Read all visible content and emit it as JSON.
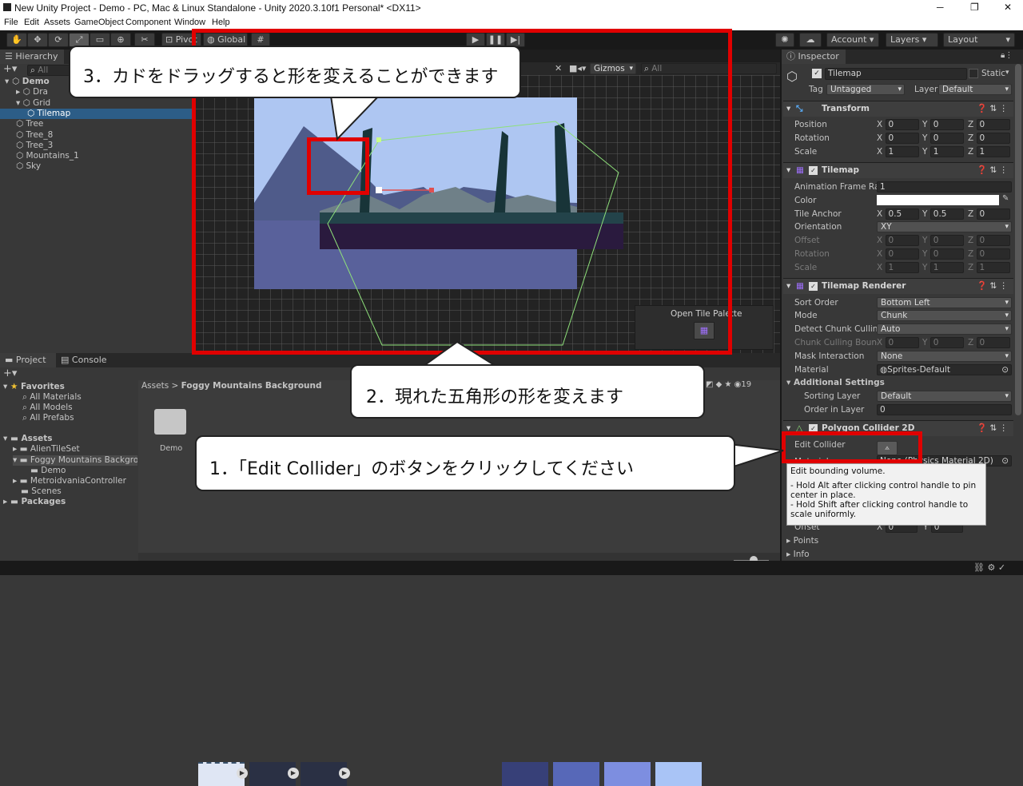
{
  "window": {
    "title": "New Unity Project - Demo - PC, Mac & Linux Standalone - Unity 2020.3.10f1 Personal* <DX11>",
    "controls": [
      "─",
      "❐",
      "✕"
    ]
  },
  "menu": [
    "File",
    "Edit",
    "Assets",
    "GameObject",
    "Component",
    "Window",
    "Help"
  ],
  "toolbar": {
    "pivot": "Pivot",
    "global": "Global",
    "account": "Account",
    "layers": "Layers",
    "layout": "Layout"
  },
  "hierarchy": {
    "tab": "Hierarchy",
    "search_placeholder": "All",
    "items": [
      {
        "label": "Demo",
        "indent": 0,
        "expanded": true,
        "bold": true
      },
      {
        "label": "Dra",
        "indent": 1,
        "expanded": false
      },
      {
        "label": "Grid",
        "indent": 1,
        "expanded": true
      },
      {
        "label": "Tilemap",
        "indent": 2,
        "selected": true
      },
      {
        "label": "Tree",
        "indent": 1
      },
      {
        "label": "Tree_8",
        "indent": 1
      },
      {
        "label": "Tree_3",
        "indent": 1
      },
      {
        "label": "Mountains_1",
        "indent": 1
      },
      {
        "label": "Sky",
        "indent": 1
      }
    ]
  },
  "scene": {
    "gizmos": "Gizmos",
    "search_placeholder": "All",
    "tile_palette_button": "Open Tile Palette"
  },
  "project": {
    "tabs": [
      "Project",
      "Console"
    ],
    "favorites": {
      "label": "Favorites",
      "items": [
        "All Materials",
        "All Models",
        "All Prefabs"
      ]
    },
    "assets": {
      "label": "Assets",
      "items": [
        {
          "label": "AlienTileSet",
          "indent": 1
        },
        {
          "label": "Foggy Mountains Backgrou",
          "indent": 1,
          "expanded": true
        },
        {
          "label": "Demo",
          "indent": 2
        },
        {
          "label": "MetroidvaniaController",
          "indent": 1
        },
        {
          "label": "Scenes",
          "indent": 1
        }
      ]
    },
    "packages": "Packages",
    "breadcrumb": [
      "Assets",
      "Foggy Mountains Background"
    ],
    "folder_label": "Demo",
    "asset_count": "19"
  },
  "inspector": {
    "tab": "Inspector",
    "object_name": "Tilemap",
    "static_label": "Static",
    "tag_label": "Tag",
    "tag_value": "Untagged",
    "layer_label": "Layer",
    "layer_value": "Default",
    "transform": {
      "title": "Transform",
      "rows": [
        {
          "label": "Position",
          "x": "0",
          "y": "0",
          "z": "0"
        },
        {
          "label": "Rotation",
          "x": "0",
          "y": "0",
          "z": "0"
        },
        {
          "label": "Scale",
          "x": "1",
          "y": "1",
          "z": "1"
        }
      ]
    },
    "tilemap": {
      "title": "Tilemap",
      "animation_frame_rate_label": "Animation Frame Rate",
      "animation_frame_rate": "1",
      "color_label": "Color",
      "tile_anchor_label": "Tile Anchor",
      "tile_anchor": {
        "x": "0.5",
        "y": "0.5",
        "z": "0"
      },
      "orientation_label": "Orientation",
      "orientation": "XY",
      "offset_label": "Offset",
      "offset": {
        "x": "0",
        "y": "0",
        "z": "0"
      },
      "rotation_label": "Rotation",
      "rotation": {
        "x": "0",
        "y": "0",
        "z": "0"
      },
      "scale_label": "Scale",
      "scale": {
        "x": "1",
        "y": "1",
        "z": "1"
      }
    },
    "tilemap_renderer": {
      "title": "Tilemap Renderer",
      "sort_order_label": "Sort Order",
      "sort_order": "Bottom Left",
      "mode_label": "Mode",
      "mode": "Chunk",
      "detect_label": "Detect Chunk Culling",
      "detect": "Auto",
      "bounds_label": "Chunk Culling Bound",
      "bounds": {
        "x": "0",
        "y": "0",
        "z": "0"
      },
      "mask_label": "Mask Interaction",
      "mask": "None",
      "material_label": "Material",
      "material": "Sprites-Default",
      "additional_label": "Additional Settings",
      "sorting_layer_label": "Sorting Layer",
      "sorting_layer": "Default",
      "order_label": "Order in Layer",
      "order": "0"
    },
    "polygon_collider": {
      "title": "Polygon Collider 2D",
      "edit_collider_label": "Edit Collider",
      "material_label": "Material",
      "material": "None (Physics Material 2D)",
      "offset_label": "Offset",
      "offset": {
        "x": "0",
        "y": "0"
      },
      "points_label": "Points",
      "info_label": "Info"
    },
    "tooltip": {
      "title": "Edit bounding volume.",
      "lines": [
        " - Hold Alt after clicking control handle to pin center in place.",
        " - Hold Shift after clicking control handle to scale uniformly."
      ]
    }
  },
  "annotations": {
    "step1": "1．「Edit Collider」のボタンをクリックしてください",
    "step2": "2．現れた五角形の形を変えます",
    "step3": "3．カドをドラッグすると形を変えることができます"
  }
}
